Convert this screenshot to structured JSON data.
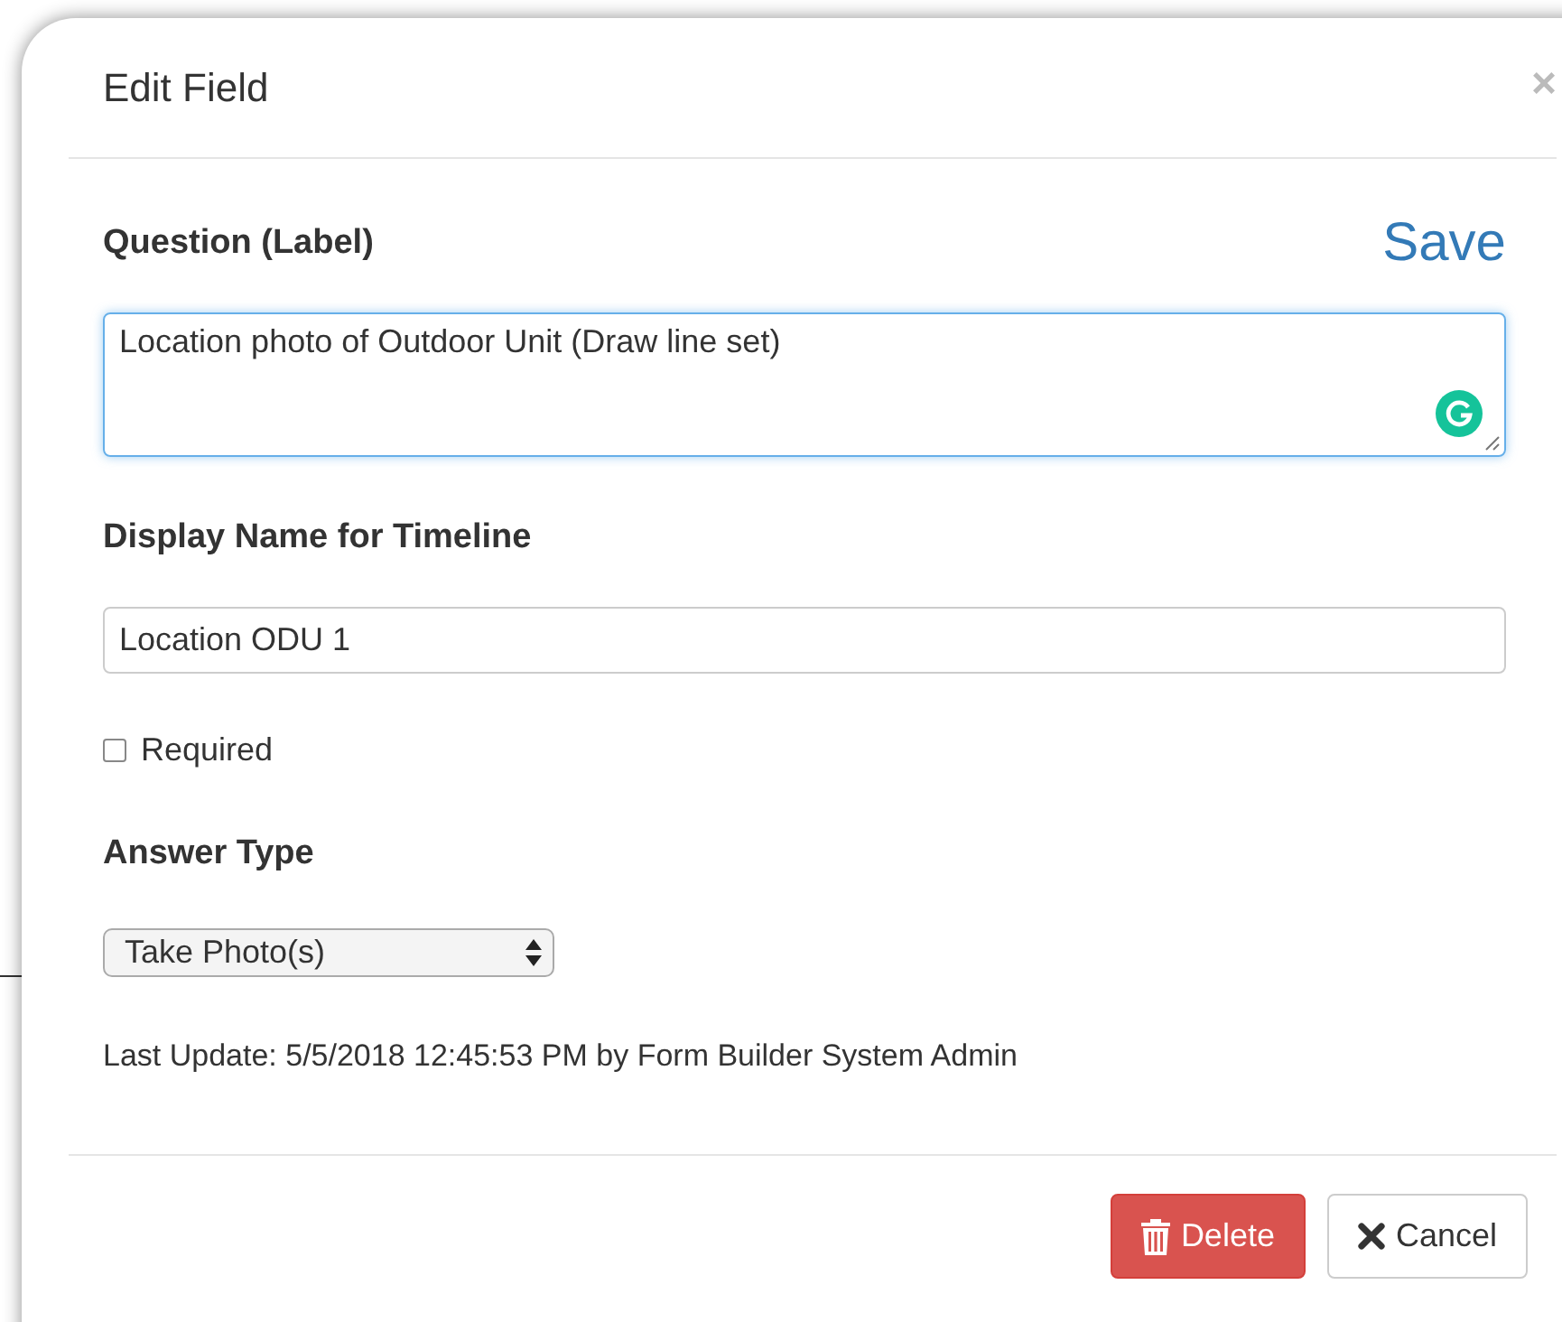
{
  "dialog": {
    "title": "Edit Field",
    "close": "×",
    "save": "Save",
    "question": {
      "label": "Question (Label)",
      "value": "Location photo of Outdoor Unit (Draw line set)"
    },
    "display_name": {
      "label": "Display Name for Timeline",
      "value": "Location ODU 1"
    },
    "required": {
      "label": "Required",
      "checked": false
    },
    "answer_type": {
      "label": "Answer Type",
      "value": "Take Photo(s)"
    },
    "last_update": "Last Update: 5/5/2018 12:45:53 PM by Form Builder System Admin",
    "buttons": [
      {
        "kind": "delete",
        "label": "Delete"
      },
      {
        "kind": "cancel",
        "label": "Cancel"
      }
    ]
  }
}
